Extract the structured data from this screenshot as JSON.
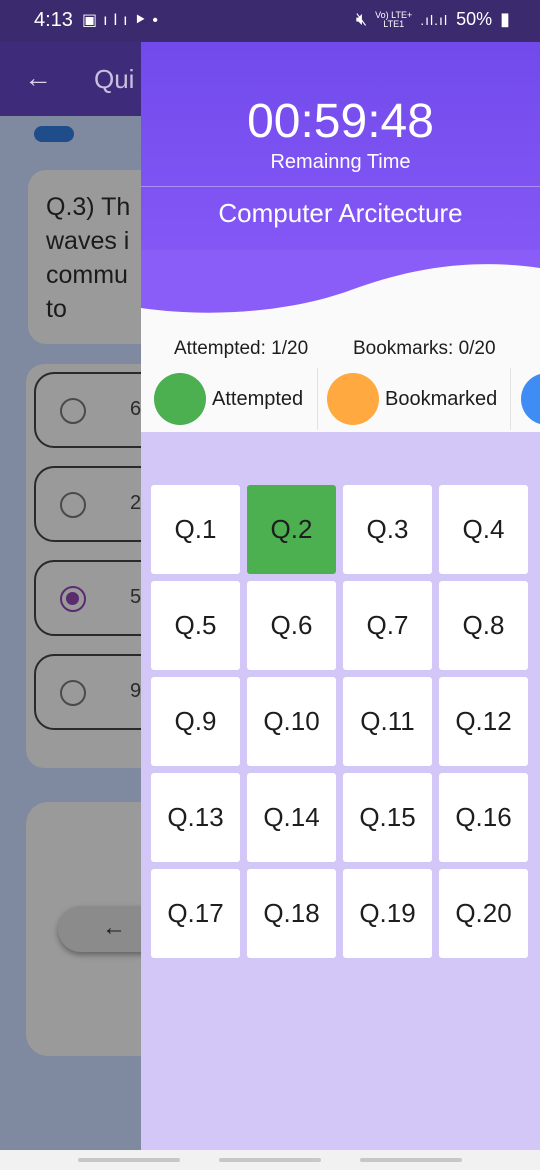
{
  "status_bar": {
    "time": "4:13",
    "left_icons": [
      "image-icon",
      "bars-icon",
      "play-icon",
      "dot"
    ],
    "network_top": "Vo) LTE+",
    "network_bottom": "LTE1",
    "battery": "50%"
  },
  "background_app": {
    "title": "Qui",
    "question_text": "Q.3) Th\nwaves i\ncommu\nto",
    "options": [
      "6",
      "2",
      "5",
      "9"
    ],
    "selected_option_index": 2
  },
  "drawer": {
    "timer": "00:59:48",
    "timer_label": "Remainng Time",
    "course_title": "Computer Arcitecture",
    "attempted_text": "Attempted: 1/20",
    "bookmarks_text": "Bookmarks: 0/20",
    "legend": [
      {
        "label": "Attempted",
        "color": "#4caf50"
      },
      {
        "label": "Bookmarked",
        "color": "#ffa940"
      },
      {
        "label": "",
        "color": "#3f8cf5"
      }
    ],
    "questions": [
      {
        "label": "Q.1",
        "state": "unanswered"
      },
      {
        "label": "Q.2",
        "state": "attempted"
      },
      {
        "label": "Q.3",
        "state": "unanswered"
      },
      {
        "label": "Q.4",
        "state": "unanswered"
      },
      {
        "label": "Q.5",
        "state": "unanswered"
      },
      {
        "label": "Q.6",
        "state": "unanswered"
      },
      {
        "label": "Q.7",
        "state": "unanswered"
      },
      {
        "label": "Q.8",
        "state": "unanswered"
      },
      {
        "label": "Q.9",
        "state": "unanswered"
      },
      {
        "label": "Q.10",
        "state": "unanswered"
      },
      {
        "label": "Q.11",
        "state": "unanswered"
      },
      {
        "label": "Q.12",
        "state": "unanswered"
      },
      {
        "label": "Q.13",
        "state": "unanswered"
      },
      {
        "label": "Q.14",
        "state": "unanswered"
      },
      {
        "label": "Q.15",
        "state": "unanswered"
      },
      {
        "label": "Q.16",
        "state": "unanswered"
      },
      {
        "label": "Q.17",
        "state": "unanswered"
      },
      {
        "label": "Q.18",
        "state": "unanswered"
      },
      {
        "label": "Q.19",
        "state": "unanswered"
      },
      {
        "label": "Q.20",
        "state": "unanswered"
      }
    ]
  },
  "colors": {
    "header_gradient_top": "#6e47ea",
    "header_gradient_bottom": "#8a5cf8",
    "drawer_background": "#d3c7f8",
    "attempted": "#4caf50",
    "bookmarked": "#ffa940"
  }
}
